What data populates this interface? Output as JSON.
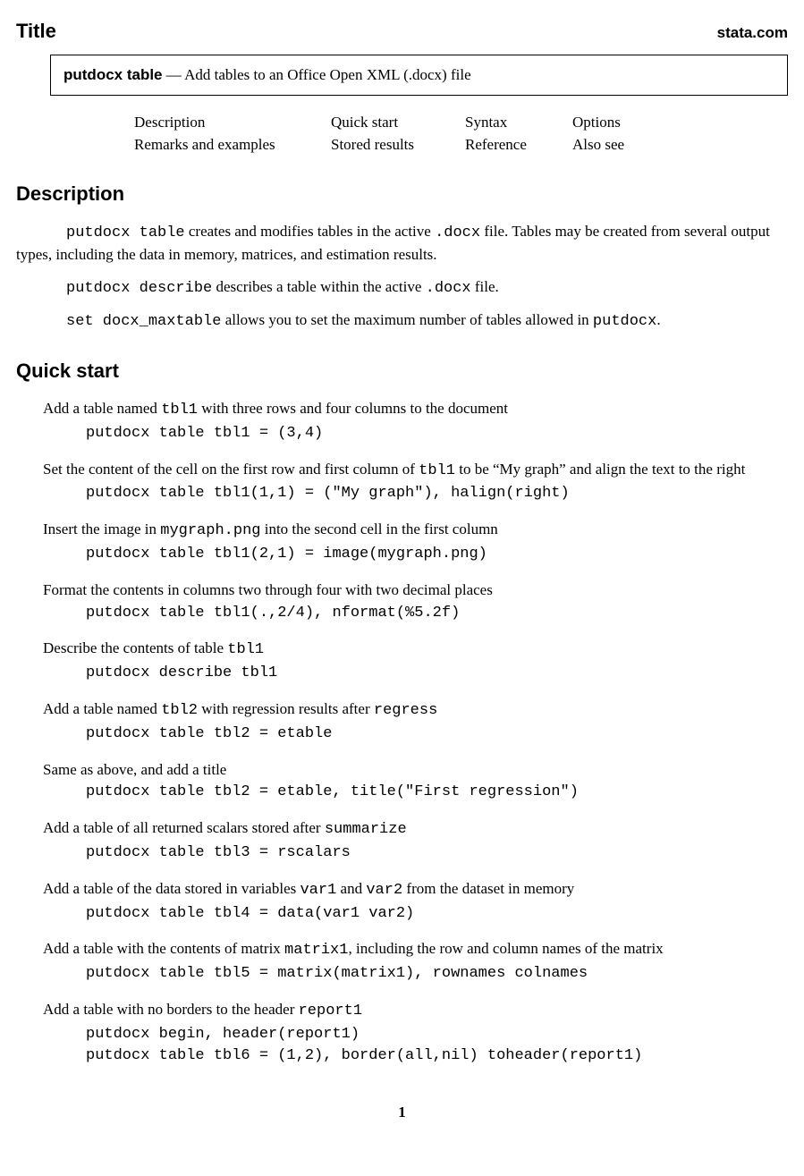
{
  "header": {
    "title": "Title",
    "site": "stata.com"
  },
  "titlebox": {
    "command": "putdocx table",
    "sep": " — ",
    "desc": "Add tables to an Office Open XML (.docx) file"
  },
  "toc": {
    "r1c1": "Description",
    "r1c2": "Quick start",
    "r1c3": "Syntax",
    "r1c4": "Options",
    "r2c1": "Remarks and examples",
    "r2c2": "Stored results",
    "r2c3": "Reference",
    "r2c4": "Also see"
  },
  "sections": {
    "description": "Description",
    "quickstart": "Quick start"
  },
  "desc": {
    "p1a": "putdocx table",
    "p1b": " creates and modifies tables in the active ",
    "p1c": ".docx",
    "p1d": " file. Tables may be created from several output types, including the data in memory, matrices, and estimation results.",
    "p2a": "putdocx describe",
    "p2b": " describes a table within the active ",
    "p2c": ".docx",
    "p2d": " file.",
    "p3a": "set docx_maxtable",
    "p3b": " allows you to set the maximum number of tables allowed in ",
    "p3c": "putdocx",
    "p3d": "."
  },
  "qs": [
    {
      "d1": "Add a table named ",
      "dt1": "tbl1",
      "d2": " with three rows and four columns to the document",
      "code": "putdocx table tbl1 = (3,4)"
    },
    {
      "d1": "Set the content of the cell on the first row and first column of ",
      "dt1": "tbl1",
      "d2": " to be “My graph” and align the text to the right",
      "code": "putdocx table tbl1(1,1) = (\"My graph\"), halign(right)"
    },
    {
      "d1": "Insert the image in ",
      "dt1": "mygraph.png",
      "d2": " into the second cell in the first column",
      "code": "putdocx table tbl1(2,1) = image(mygraph.png)"
    },
    {
      "d1": "Format the contents in columns two through four with two decimal places",
      "dt1": "",
      "d2": "",
      "code": "putdocx table tbl1(.,2/4), nformat(%5.2f)"
    },
    {
      "d1": "Describe the contents of table ",
      "dt1": "tbl1",
      "d2": "",
      "code": "putdocx describe tbl1"
    },
    {
      "d1": "Add a table named ",
      "dt1": "tbl2",
      "d2": " with regression results after ",
      "dt2": "regress",
      "code": "putdocx table tbl2 = etable"
    },
    {
      "d1": "Same as above, and add a title",
      "dt1": "",
      "d2": "",
      "code": "putdocx table tbl2 = etable, title(\"First regression\")"
    },
    {
      "d1": "Add a table of all returned scalars stored after ",
      "dt1": "summarize",
      "d2": "",
      "code": "putdocx table tbl3 = rscalars"
    },
    {
      "d1": "Add a table of the data stored in variables ",
      "dt1": "var1",
      "d2": " and ",
      "dt2": "var2",
      "d3": " from the dataset in memory",
      "code": "putdocx table tbl4 = data(var1 var2)"
    },
    {
      "d1": "Add a table with the contents of matrix ",
      "dt1": "matrix1",
      "d2": ", including the row and column names of the matrix",
      "code": "putdocx table tbl5 = matrix(matrix1), rownames colnames"
    },
    {
      "d1": "Add a table with no borders to the header ",
      "dt1": "report1",
      "d2": "",
      "code": "putdocx begin, header(report1)\nputdocx table tbl6 = (1,2), border(all,nil) toheader(report1)"
    }
  ],
  "pagenum": "1"
}
